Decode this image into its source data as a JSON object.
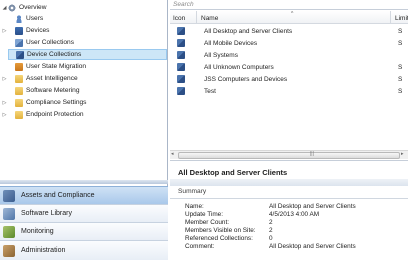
{
  "tree": {
    "items": [
      {
        "label": "Overview",
        "icon": "gear-icon",
        "expander": "◢"
      },
      {
        "label": "Users",
        "icon": "user-icon",
        "expander": ""
      },
      {
        "label": "Devices",
        "icon": "devices-icon",
        "expander": "▷"
      },
      {
        "label": "User Collections",
        "icon": "user-collections-icon",
        "expander": ""
      },
      {
        "label": "Device Collections",
        "icon": "device-collections-icon",
        "expander": ""
      },
      {
        "label": "User State Migration",
        "icon": "user-state-migration-icon",
        "expander": ""
      },
      {
        "label": "Asset Intelligence",
        "icon": "folder-icon",
        "expander": "▷"
      },
      {
        "label": "Software Metering",
        "icon": "folder-icon",
        "expander": ""
      },
      {
        "label": "Compliance Settings",
        "icon": "folder-icon",
        "expander": "▷"
      },
      {
        "label": "Endpoint Protection",
        "icon": "folder-icon",
        "expander": "▷"
      }
    ],
    "selected_index": 4
  },
  "workspaces": [
    {
      "label": "Assets and Compliance",
      "icon": "assets-compliance-icon",
      "active": true
    },
    {
      "label": "Software Library",
      "icon": "software-library-icon",
      "active": false
    },
    {
      "label": "Monitoring",
      "icon": "monitoring-icon",
      "active": false
    },
    {
      "label": "Administration",
      "icon": "administration-icon",
      "active": false
    }
  ],
  "search": {
    "placeholder": "Search"
  },
  "grid": {
    "columns": [
      "Icon",
      "Name",
      "Limit"
    ],
    "sort_indicator": "^",
    "rows": [
      {
        "name": "All Desktop and Server Clients",
        "limit": "S"
      },
      {
        "name": "All Mobile Devices",
        "limit": "S"
      },
      {
        "name": "All Systems",
        "limit": ""
      },
      {
        "name": "All Unknown Computers",
        "limit": "S"
      },
      {
        "name": "JSS Computers and Devices",
        "limit": "S"
      },
      {
        "name": "Test",
        "limit": "S"
      }
    ],
    "scroll_grip": "|||",
    "scroll_left": "◂",
    "scroll_right": "▸"
  },
  "detail": {
    "title": "All Desktop and Server Clients",
    "section": "Summary",
    "properties": [
      {
        "label": "Name:",
        "value": "All Desktop and Server Clients"
      },
      {
        "label": "Update Time:",
        "value": "4/5/2013 4:00 AM"
      },
      {
        "label": "Member Count:",
        "value": "2"
      },
      {
        "label": "Members Visible on Site:",
        "value": "2"
      },
      {
        "label": "Referenced Collections:",
        "value": "0"
      },
      {
        "label": "Comment:",
        "value": "All Desktop and Server Clients"
      }
    ]
  },
  "colors": {
    "selection": "#cde6f7",
    "active_workspace": "#a9c8ea",
    "pane_border": "#aab6c8"
  }
}
